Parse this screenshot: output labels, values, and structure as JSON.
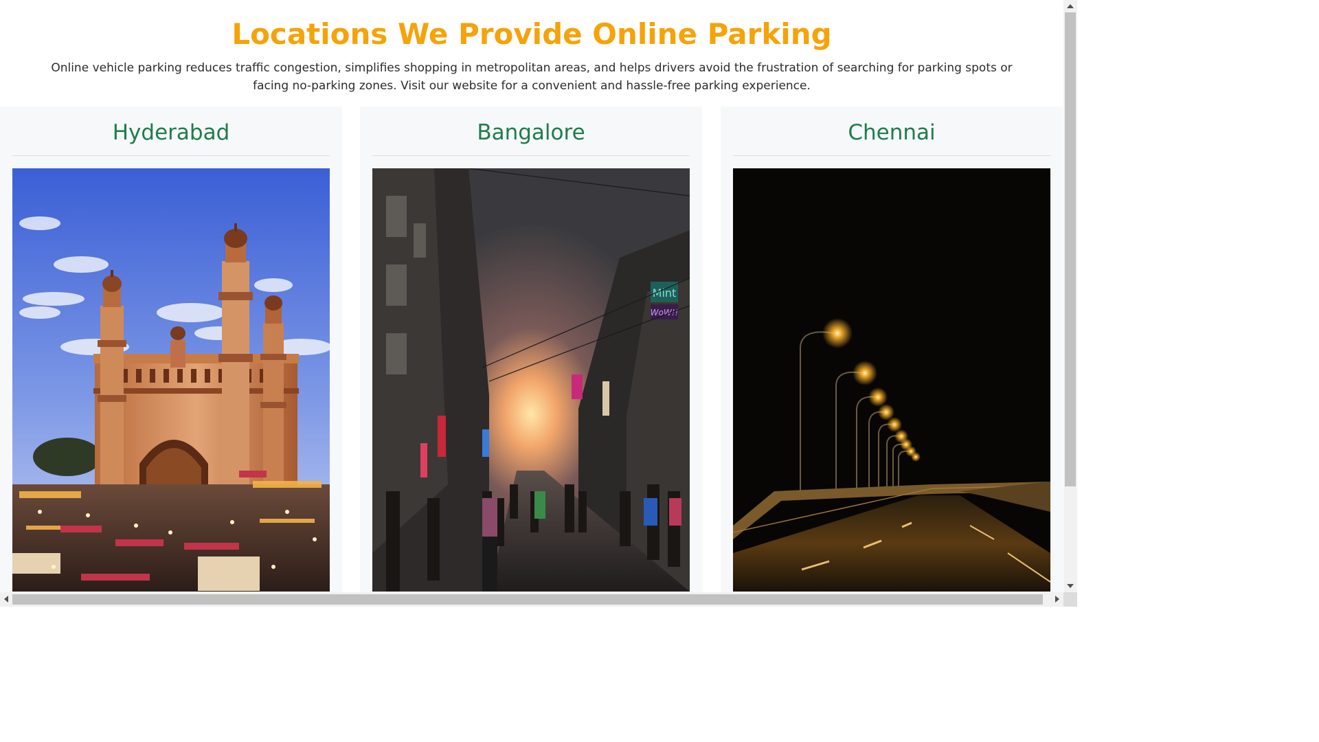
{
  "header": {
    "title": "Locations We Provide Online Parking",
    "description": "Online vehicle parking reduces traffic congestion, simplifies shopping in metropolitan areas, and helps drivers avoid the frustration of searching for parking spots or facing no-parking zones. Visit our website for a convenient and hassle-free parking experience."
  },
  "locations": [
    {
      "name": "Hyderabad"
    },
    {
      "name": "Bangalore"
    },
    {
      "name": "Chennai"
    }
  ],
  "signs": {
    "shop_name": "Mint",
    "shop_name2": "WoW!!"
  },
  "colors": {
    "title": "#f5a30a",
    "city_name": "#1e7d4b",
    "card_background": "#f6f8f9"
  }
}
